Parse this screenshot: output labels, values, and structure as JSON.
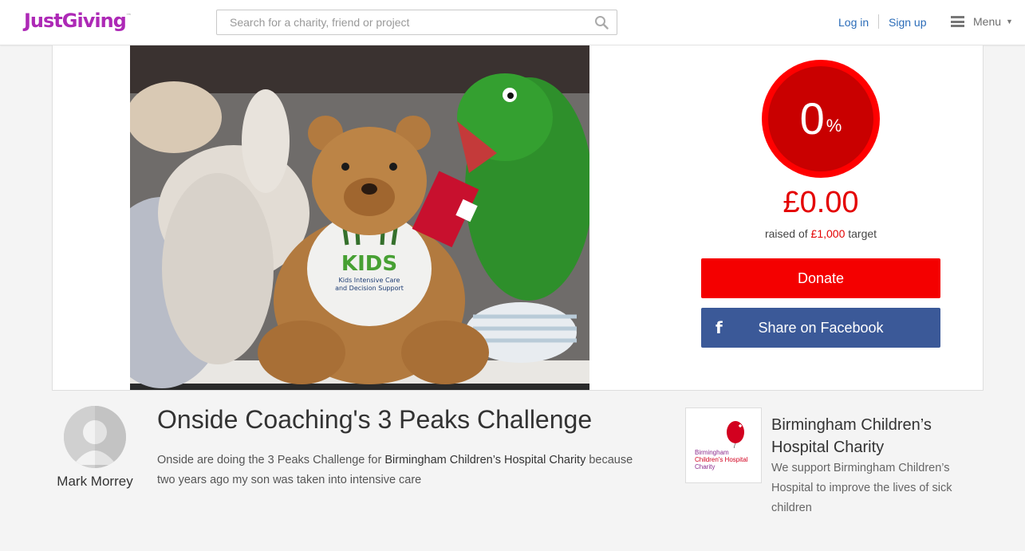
{
  "header": {
    "logo": "JustGiving",
    "logo_tm": "™",
    "search_placeholder": "Search for a charity, friend or project",
    "login": "Log in",
    "signup": "Sign up",
    "menu": "Menu"
  },
  "fundraising": {
    "percent": "0",
    "percent_symbol": "%",
    "progress_fraction": 0,
    "raised": "£0.00",
    "raised_prefix": "raised of ",
    "target": "£1,000",
    "raised_suffix": " target",
    "donate_label": "Donate",
    "share_label": "Share on Facebook"
  },
  "photo": {
    "tshirt_text": "KIDS",
    "tshirt_sub1": "Kids Intensive Care",
    "tshirt_sub2": "and Decision Support"
  },
  "owner": {
    "name": "Mark Morrey"
  },
  "page": {
    "title": "Onside Coaching's 3 Peaks Challenge",
    "story_prefix": "Onside are doing the 3 Peaks Challenge for ",
    "story_charity": "Birmingham Children’s Hospital Charity",
    "story_suffix": " because two years ago my son was taken into intensive care"
  },
  "charity": {
    "logo_line1": "Birmingham",
    "logo_line2": "Children's Hospital",
    "logo_line3": "Charity",
    "name": "Birmingham Children’s Hospital Charity",
    "description": "We support Birmingham Children’s Hospital to improve the lives of sick children"
  },
  "colors": {
    "brand": "#ad29b6",
    "donate": "#f40000",
    "facebook": "#3b5998",
    "progress": "#ff0000",
    "link": "#2b6cb8"
  },
  "icons": {
    "search": "search-icon",
    "menu": "hamburger-icon",
    "facebook": "facebook-icon"
  }
}
